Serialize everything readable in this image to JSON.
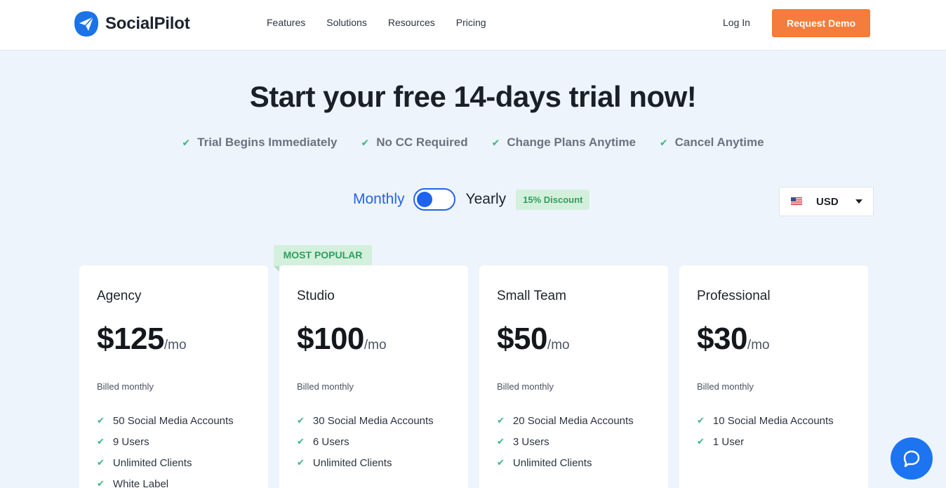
{
  "header": {
    "brand": "SocialPilot",
    "nav": [
      "Features",
      "Solutions",
      "Resources",
      "Pricing"
    ],
    "login": "Log In",
    "demo": "Request Demo"
  },
  "hero": {
    "title": "Start your free 14-days trial now!",
    "perks": [
      "Trial Begins Immediately",
      "No CC Required",
      "Change Plans Anytime",
      "Cancel Anytime"
    ]
  },
  "billing": {
    "monthly": "Monthly",
    "yearly": "Yearly",
    "discount": "15% Discount",
    "currency": "USD",
    "selected": "Monthly"
  },
  "colors": {
    "accent_blue": "#2563eb",
    "orange": "#f47c3c",
    "green": "#3bb77e"
  },
  "plans": [
    {
      "name": "Agency",
      "price": "$125",
      "unit": "/mo",
      "billed": "Billed monthly",
      "features": [
        "50 Social Media Accounts",
        "9 Users",
        "Unlimited Clients",
        "White Label"
      ]
    },
    {
      "name": "Studio",
      "price": "$100",
      "unit": "/mo",
      "billed": "Billed monthly",
      "ribbon": "MOST POPULAR",
      "features": [
        "30 Social Media Accounts",
        "6 Users",
        "Unlimited Clients"
      ]
    },
    {
      "name": "Small Team",
      "price": "$50",
      "unit": "/mo",
      "billed": "Billed monthly",
      "features": [
        "20 Social Media Accounts",
        "3 Users",
        "Unlimited Clients"
      ]
    },
    {
      "name": "Professional",
      "price": "$30",
      "unit": "/mo",
      "billed": "Billed monthly",
      "features": [
        "10 Social Media Accounts",
        "1 User"
      ]
    }
  ]
}
